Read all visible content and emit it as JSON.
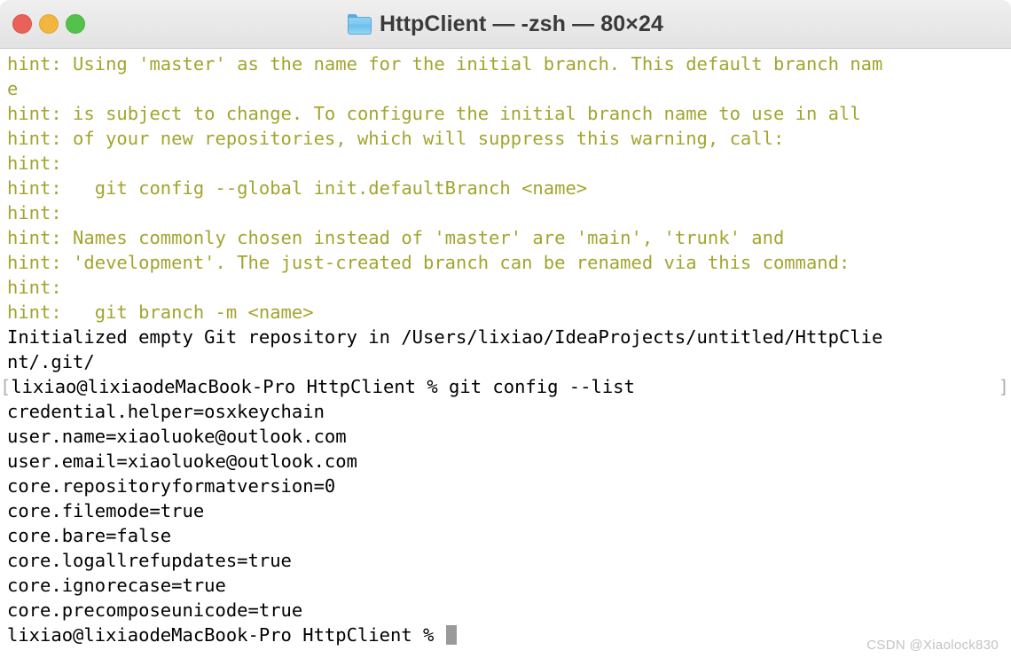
{
  "window": {
    "title": "HttpClient — -zsh — 80×24",
    "folder_icon": "folder-icon",
    "traffic_lights": [
      {
        "name": "close",
        "color": "#e8625a"
      },
      {
        "name": "minimize",
        "color": "#f2b640"
      },
      {
        "name": "maximize",
        "color": "#55c14d"
      }
    ]
  },
  "terminal": {
    "colors": {
      "background": "#ffffff",
      "foreground": "#000000",
      "hint": "#a2a52e",
      "prompt_marker": "#b0b0b0",
      "cursor": "#9a9a9a"
    },
    "lines": [
      {
        "kind": "hint",
        "text": "hint: Using 'master' as the name for the initial branch. This default branch nam"
      },
      {
        "kind": "hint",
        "text": "e"
      },
      {
        "kind": "hint",
        "text": "hint: is subject to change. To configure the initial branch name to use in all"
      },
      {
        "kind": "hint",
        "text": "hint: of your new repositories, which will suppress this warning, call:"
      },
      {
        "kind": "hint",
        "text": "hint:"
      },
      {
        "kind": "hint",
        "text": "hint:   git config --global init.defaultBranch <name>"
      },
      {
        "kind": "hint",
        "text": "hint:"
      },
      {
        "kind": "hint",
        "text": "hint: Names commonly chosen instead of 'master' are 'main', 'trunk' and"
      },
      {
        "kind": "hint",
        "text": "hint: 'development'. The just-created branch can be renamed via this command:"
      },
      {
        "kind": "hint",
        "text": "hint:"
      },
      {
        "kind": "hint",
        "text": "hint:   git branch -m <name>"
      },
      {
        "kind": "out",
        "text": "Initialized empty Git repository in /Users/lixiao/IdeaProjects/untitled/HttpClie"
      },
      {
        "kind": "out",
        "text": "nt/.git/"
      },
      {
        "kind": "marked",
        "bracket_left": "[",
        "text": "lixiao@lixiaodeMacBook-Pro HttpClient % git config --list",
        "bracket_right": "]"
      },
      {
        "kind": "out",
        "text": "credential.helper=osxkeychain"
      },
      {
        "kind": "out",
        "text": "user.name=xiaoluoke@outlook.com"
      },
      {
        "kind": "out",
        "text": "user.email=xiaoluoke@outlook.com"
      },
      {
        "kind": "out",
        "text": "core.repositoryformatversion=0"
      },
      {
        "kind": "out",
        "text": "core.filemode=true"
      },
      {
        "kind": "out",
        "text": "core.bare=false"
      },
      {
        "kind": "out",
        "text": "core.logallrefupdates=true"
      },
      {
        "kind": "out",
        "text": "core.ignorecase=true"
      },
      {
        "kind": "out",
        "text": "core.precomposeunicode=true"
      }
    ],
    "prompt_line": {
      "text": "lixiao@lixiaodeMacBook-Pro HttpClient % ",
      "cursor": "block"
    }
  },
  "watermark": {
    "text": "CSDN @Xiaolock830"
  }
}
